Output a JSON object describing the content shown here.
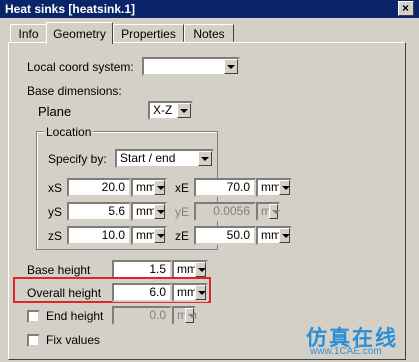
{
  "window": {
    "title": "Heat sinks [heatsink.1]"
  },
  "tabs": [
    {
      "label": "Info",
      "active": false
    },
    {
      "label": "Geometry",
      "active": true
    },
    {
      "label": "Properties",
      "active": false
    },
    {
      "label": "Notes",
      "active": false
    }
  ],
  "geometry": {
    "local_coord_label": "Local coord system:",
    "local_coord_value": "",
    "base_dimensions_label": "Base dimensions:",
    "plane_label": "Plane",
    "plane_value": "X-Z",
    "location": {
      "legend": "Location",
      "specify_by_label": "Specify by:",
      "specify_by_value": "Start / end",
      "xS": {
        "label": "xS",
        "value": "20.0",
        "unit": "mm"
      },
      "xE": {
        "label": "xE",
        "value": "70.0",
        "unit": "mm"
      },
      "yS": {
        "label": "yS",
        "value": "5.6",
        "unit": "mm"
      },
      "yE": {
        "label": "yE",
        "value": "0.0056",
        "unit": "m"
      },
      "zS": {
        "label": "zS",
        "value": "10.0",
        "unit": "mm"
      },
      "zE": {
        "label": "zE",
        "value": "50.0",
        "unit": "mm"
      }
    },
    "base_height": {
      "label": "Base height",
      "value": "1.5",
      "unit": "mm"
    },
    "overall_height": {
      "label": "Overall height",
      "value": "6.0",
      "unit": "mm"
    },
    "end_height": {
      "label": "End height",
      "value": "0.0",
      "unit": "mm",
      "checked": false
    },
    "fix_values": {
      "label": "Fix values",
      "checked": false
    }
  },
  "watermark": {
    "text_cn": "仿真在线",
    "url": "www.1CAE.com"
  },
  "colors": {
    "titlebar": "#0a246a",
    "highlight": "#e0252a",
    "watermark": "#2a8fd8"
  }
}
